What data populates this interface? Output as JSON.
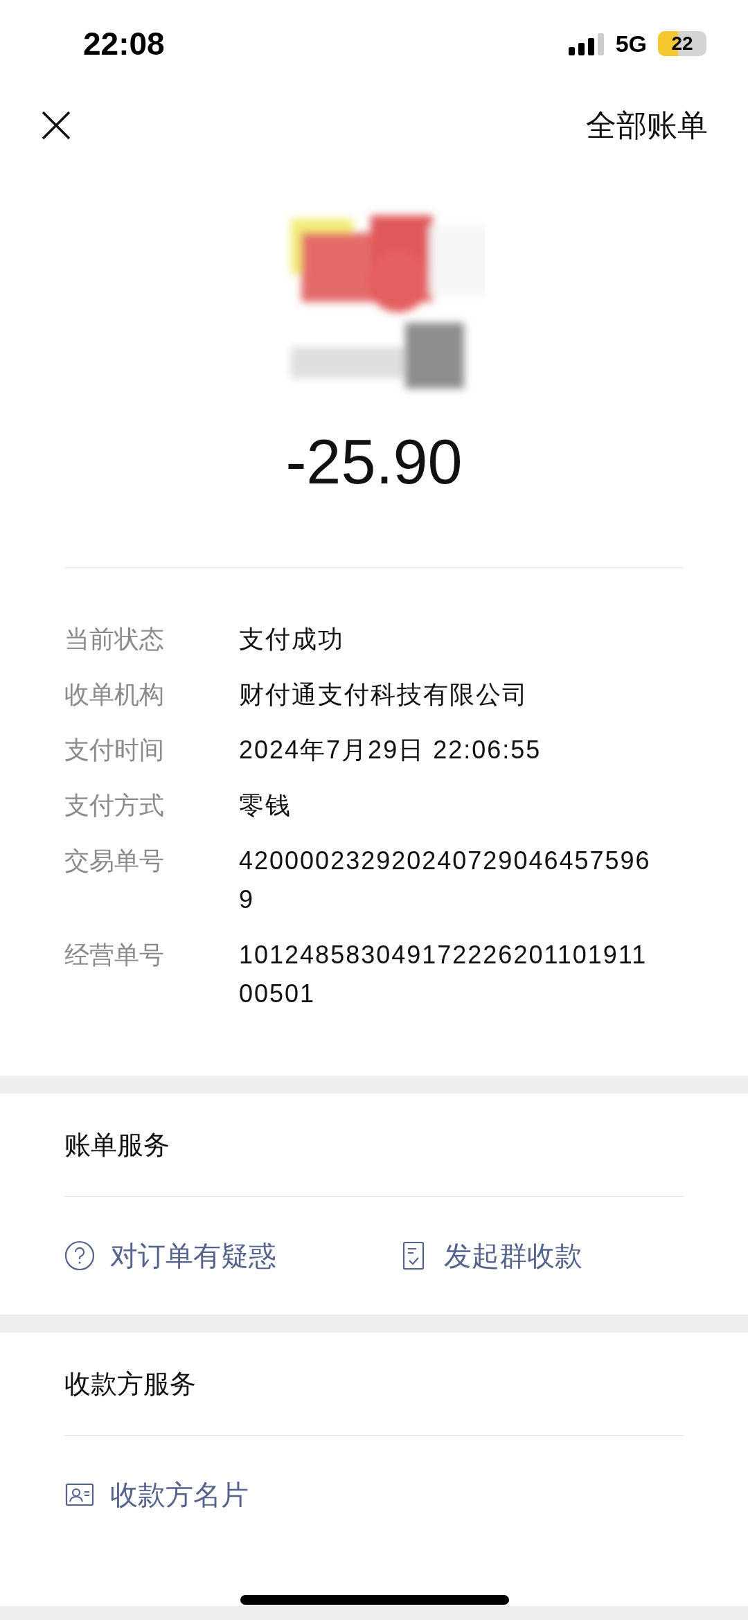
{
  "status_bar": {
    "time": "22:08",
    "network": "5G",
    "battery": "22"
  },
  "nav": {
    "action": "全部账单"
  },
  "amount": "-25.90",
  "details": [
    {
      "label": "当前状态",
      "value": "支付成功"
    },
    {
      "label": "收单机构",
      "value": "财付通支付科技有限公司"
    },
    {
      "label": "支付时间",
      "value": "2024年7月29日 22:06:55"
    },
    {
      "label": "支付方式",
      "value": "零钱"
    },
    {
      "label": "交易单号",
      "value": "4200002329202407290464575969"
    },
    {
      "label": "经营单号",
      "value": "10124858304917222620110191100501"
    }
  ],
  "sections": [
    {
      "title": "账单服务",
      "actions": [
        {
          "kind": "question",
          "label": "对订单有疑惑"
        },
        {
          "kind": "bill",
          "label": "发起群收款"
        }
      ]
    },
    {
      "title": "收款方服务",
      "actions": [
        {
          "kind": "card",
          "label": "收款方名片"
        }
      ]
    }
  ]
}
